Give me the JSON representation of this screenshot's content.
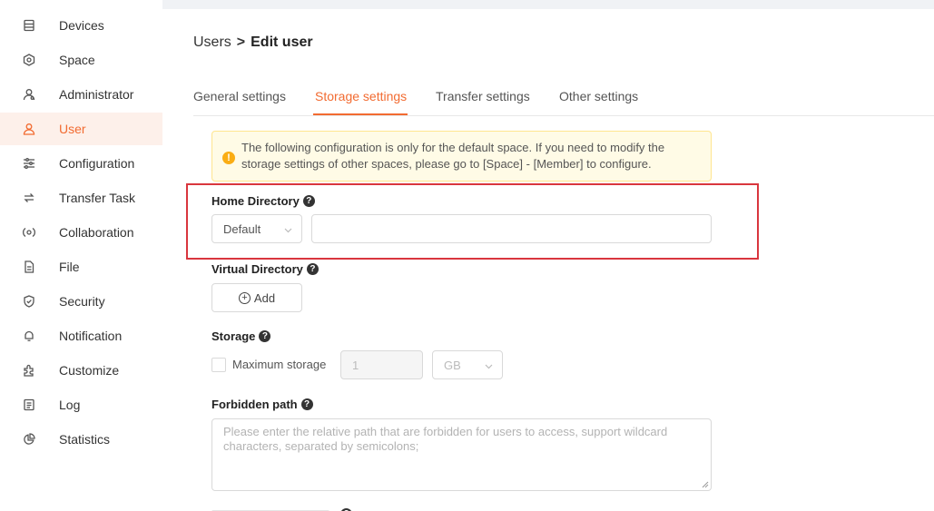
{
  "sidebar": {
    "items": [
      {
        "label": "Devices",
        "icon": "devices-icon",
        "active": false
      },
      {
        "label": "Space",
        "icon": "space-icon",
        "active": false
      },
      {
        "label": "Administrator",
        "icon": "administrator-icon",
        "active": false
      },
      {
        "label": "User",
        "icon": "user-icon",
        "active": true
      },
      {
        "label": "Configuration",
        "icon": "configuration-icon",
        "active": false
      },
      {
        "label": "Transfer Task",
        "icon": "transfer-task-icon",
        "active": false
      },
      {
        "label": "Collaboration",
        "icon": "collaboration-icon",
        "active": false
      },
      {
        "label": "File",
        "icon": "file-icon",
        "active": false
      },
      {
        "label": "Security",
        "icon": "security-icon",
        "active": false
      },
      {
        "label": "Notification",
        "icon": "bell-icon",
        "active": false
      },
      {
        "label": "Customize",
        "icon": "customize-icon",
        "active": false
      },
      {
        "label": "Log",
        "icon": "log-icon",
        "active": false
      },
      {
        "label": "Statistics",
        "icon": "statistics-icon",
        "active": false
      }
    ]
  },
  "breadcrumb": {
    "parent": "Users",
    "separator": ">",
    "current": "Edit user"
  },
  "tabs": [
    {
      "label": "General settings",
      "active": false
    },
    {
      "label": "Storage settings",
      "active": true
    },
    {
      "label": "Transfer settings",
      "active": false
    },
    {
      "label": "Other settings",
      "active": false
    }
  ],
  "notice": {
    "text": "The following configuration is only for the default space. If you need to modify the storage settings of other spaces, please go to [Space] - [Member] to configure."
  },
  "home_directory": {
    "label": "Home Directory",
    "select_value": "Default",
    "input_value": ""
  },
  "virtual_directory": {
    "label": "Virtual Directory",
    "add_label": "Add"
  },
  "storage": {
    "label": "Storage",
    "checkbox_label": "Maximum storage",
    "checked": false,
    "amount": "1",
    "unit": "GB"
  },
  "forbidden_path": {
    "label": "Forbidden path",
    "placeholder": "Please enter the relative path that are forbidden for users to access, support wildcard characters, separated by semicolons;"
  },
  "colors": {
    "accent": "#f26b31",
    "highlight_border": "#d9363e",
    "notice_bg": "#fffbe6",
    "notice_icon": "#faad14"
  }
}
